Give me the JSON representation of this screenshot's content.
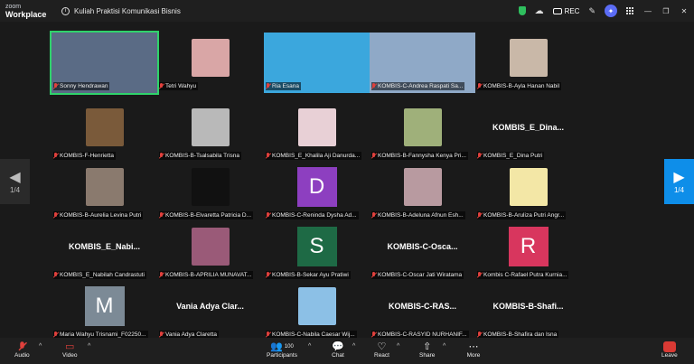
{
  "app": {
    "brand_top": "zoom",
    "brand_bottom": "Workplace"
  },
  "meeting": {
    "title": "Kuliah Praktisi Komunikasi Bisnis",
    "info_icon": "i",
    "rec_label": "REC"
  },
  "colors": {
    "accent": "#0e8ee9",
    "active_speaker": "#2fd36b",
    "muted": "#e0403c",
    "topbar": "#1f1f1f",
    "background": "#1a1a1a"
  },
  "pager": {
    "left_label": "1/4",
    "right_label": "1/4",
    "left_arrow": "◀",
    "right_arrow": "▶"
  },
  "participants": [
    {
      "name": "Sonny Hendrawan",
      "kind": "video",
      "color": "#5a6b85",
      "active": true
    },
    {
      "name": "Tetri Wahyu",
      "kind": "thumb",
      "color": "#d9a6a6"
    },
    {
      "name": "Ria Esana",
      "kind": "video",
      "color": "#3ba7dd"
    },
    {
      "name": "KOMBIS-C-Andrea Raspati Sa...",
      "kind": "video",
      "color": "#8fa9c7"
    },
    {
      "name": "KOMBIS-B-Ayla Hanan Nabil",
      "kind": "thumb",
      "color": "#c9b8a8"
    },
    {
      "name": "KOMBIS-F-Henrietta",
      "kind": "thumb",
      "color": "#7a5a3a"
    },
    {
      "name": "KOMBIS-B-Tsalsabila Trisna",
      "kind": "thumb",
      "color": "#b9b9b9"
    },
    {
      "name": "KOMBIS_E_Khalila Aji Danurda...",
      "kind": "thumb",
      "color": "#e8d0d6"
    },
    {
      "name": "KOMBIS-B-Fannysha Kenya Pri...",
      "kind": "thumb",
      "color": "#9fb07a"
    },
    {
      "name": "KOMBIS_E_Dina Putri",
      "kind": "name",
      "display": "KOMBIS_E_Dina..."
    },
    {
      "name": "KOMBIS-B-Aurelia Levina Putri",
      "kind": "thumb",
      "color": "#8a7a6e"
    },
    {
      "name": "KOMBIS-B-Elvaretta Patricia D...",
      "kind": "thumb",
      "color": "#111111"
    },
    {
      "name": "KOMBIS-C-Reninda Dysha Ad...",
      "kind": "letter",
      "letter": "D",
      "color": "#8d3fc0"
    },
    {
      "name": "KOMBIS-B-Adeluna Afnun Esh...",
      "kind": "thumb",
      "color": "#b89aa0"
    },
    {
      "name": "KOMBIS-B-Aruliza Putri Angr...",
      "kind": "thumb",
      "color": "#f3e7a6"
    },
    {
      "name": "KOMBIS_E_Nabilah Candrastuti",
      "kind": "name",
      "display": "KOMBIS_E_Nabi..."
    },
    {
      "name": "KOMBIS-B-APRILIA MUNAVAT...",
      "kind": "thumb",
      "color": "#9a5a78"
    },
    {
      "name": "KOMBIS-B-Sekar Ayu Pratiwi",
      "kind": "letter",
      "letter": "S",
      "color": "#1e6a45"
    },
    {
      "name": "KOMBIS-C-Oscar Jati Wiratama",
      "kind": "name",
      "display": "KOMBIS-C-Osca..."
    },
    {
      "name": "Kombis C-Rafael Putra Kurnia...",
      "kind": "letter",
      "letter": "R",
      "color": "#d8365e"
    },
    {
      "name": "Maria Wahyu Trisnami_F02250...",
      "kind": "letter",
      "letter": "M",
      "color": "#7c8a96"
    },
    {
      "name": "Vania Adya Claretta",
      "kind": "name",
      "display": "Vania Adya Clar..."
    },
    {
      "name": "KOMBIS-C-Nabila Caesar Wij...",
      "kind": "thumb",
      "color": "#8cc0e6"
    },
    {
      "name": "KOMBIS-C-RASYID NURHANIF...",
      "kind": "name",
      "display": "KOMBIS-C-RAS..."
    },
    {
      "name": "KOMBIS-B-Shafira dan Isna",
      "kind": "name",
      "display": "KOMBIS-B-Shafi..."
    }
  ],
  "toolbar": {
    "audio": "Audio",
    "video": "Video",
    "participants": "Participants",
    "participants_count": "100",
    "chat": "Chat",
    "react": "React",
    "share": "Share",
    "more": "More",
    "leave": "Leave"
  }
}
